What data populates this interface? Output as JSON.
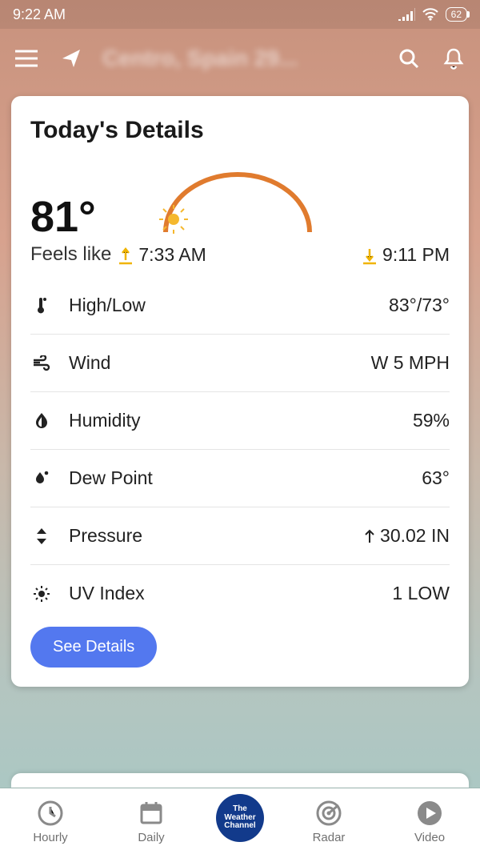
{
  "status_bar": {
    "time": "9:22 AM",
    "battery": "62"
  },
  "header": {
    "location_blur": "Centro, Spain 29..."
  },
  "card": {
    "title": "Today's Details",
    "feels_temp": "81°",
    "feels_label": "Feels like",
    "sunrise": "7:33 AM",
    "sunset": "9:11 PM",
    "rows": {
      "highlow": {
        "label": "High/Low",
        "value": "83°/73°"
      },
      "wind": {
        "label": "Wind",
        "value": "W 5 MPH"
      },
      "humidity": {
        "label": "Humidity",
        "value": "59%"
      },
      "dew": {
        "label": "Dew Point",
        "value": "63°"
      },
      "pressure": {
        "label": "Pressure",
        "value": "30.02 IN"
      },
      "uv": {
        "label": "UV Index",
        "value": "1 LOW"
      }
    },
    "see_details": "See Details"
  },
  "nav": {
    "hourly": "Hourly",
    "daily": "Daily",
    "center": "The\nWeather\nChannel",
    "radar": "Radar",
    "video": "Video"
  }
}
